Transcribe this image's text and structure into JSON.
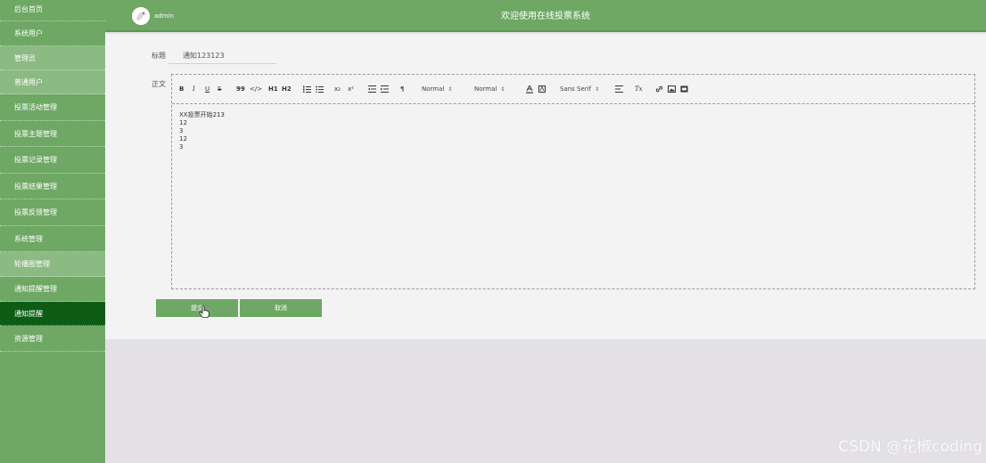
{
  "sidebar": {
    "items": [
      {
        "label": "后台首页"
      },
      {
        "label": "系统用户"
      },
      {
        "label": "管理员"
      },
      {
        "label": "普通用户"
      },
      {
        "label": "投票活动管理"
      },
      {
        "label": "投票主题管理"
      },
      {
        "label": "投票记录管理"
      },
      {
        "label": "投票结果管理"
      },
      {
        "label": "投票反馈管理"
      },
      {
        "label": "系统管理"
      },
      {
        "label": "轮播图管理"
      },
      {
        "label": "通知提醒管理"
      },
      {
        "label": "通知提醒"
      },
      {
        "label": "资源管理"
      }
    ],
    "active": "通知提醒"
  },
  "header": {
    "username": "admin",
    "title": "欢迎使用在线投票系统"
  },
  "form": {
    "title_label": "标题",
    "title_value": "通知123123",
    "body_label": "正文",
    "toolbar": {
      "bold": "B",
      "italic": "I",
      "underline": "U",
      "strike": "S",
      "quote": "99",
      "code": "</>",
      "h1": "H1",
      "h2": "H2",
      "subscript": "x₂",
      "superscript": "x²",
      "direction": "¶",
      "size_select": "Normal",
      "header_select": "Normal",
      "font_select": "Sans Serif",
      "clean": "Tx"
    },
    "content_lines": [
      "XX投票开始213",
      "12",
      "3",
      "12",
      "3"
    ],
    "submit_label": "提交",
    "cancel_label": "取消"
  },
  "watermark": "CSDN @花椒coding",
  "colors": {
    "sidebar": "#6ea864",
    "active": "#0d5c16",
    "panel": "#f3f3f3",
    "background": "#e3e1e6"
  }
}
